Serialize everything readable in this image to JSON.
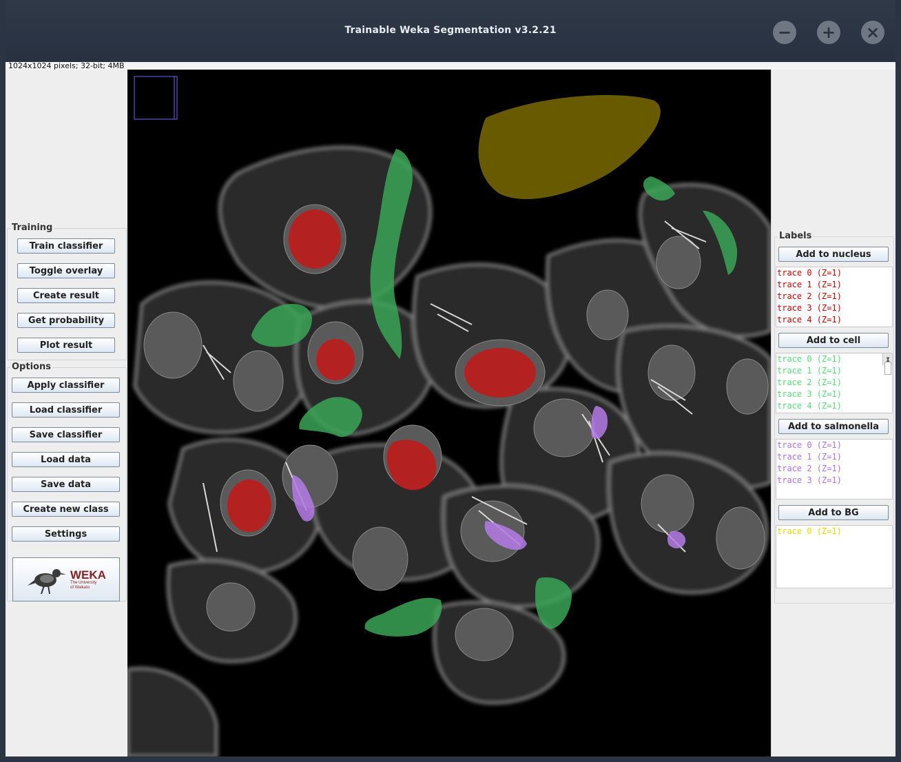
{
  "window": {
    "title": "Trainable Weka Segmentation v3.2.21"
  },
  "status": "1024x1024 pixels; 32-bit; 4MB",
  "training": {
    "label": "Training",
    "buttons": [
      "Train classifier",
      "Toggle overlay",
      "Create result",
      "Get probability",
      "Plot result"
    ]
  },
  "options": {
    "label": "Options",
    "buttons": [
      "Apply classifier",
      "Load classifier",
      "Save classifier",
      "Load data",
      "Save data",
      "Create new class",
      "Settings"
    ]
  },
  "weka_logo": {
    "name": "WEKA",
    "sub1": "The University",
    "sub2": "of Waikato"
  },
  "labels": {
    "title": "Labels",
    "classes": [
      {
        "button": "Add to nucleus",
        "color": "#cc0000",
        "traces": [
          "trace 0 (Z=1)",
          "trace 1 (Z=1)",
          "trace 2 (Z=1)",
          "trace 3 (Z=1)",
          "trace 4 (Z=1)"
        ]
      },
      {
        "button": "Add to cell",
        "color": "#55dd77",
        "traces": [
          "trace 0 (Z=1)",
          "trace 1 (Z=1)",
          "trace 2 (Z=1)",
          "trace 3 (Z=1)",
          "trace 4 (Z=1)"
        ]
      },
      {
        "button": "Add to salmonella",
        "color": "#b070e8",
        "traces": [
          "trace 0 (Z=1)",
          "trace 1 (Z=1)",
          "trace 2 (Z=1)",
          "trace 3 (Z=1)"
        ]
      },
      {
        "button": "Add to BG",
        "color": "#e6d800",
        "traces": [
          "trace 0 (Z=1)"
        ]
      }
    ]
  }
}
